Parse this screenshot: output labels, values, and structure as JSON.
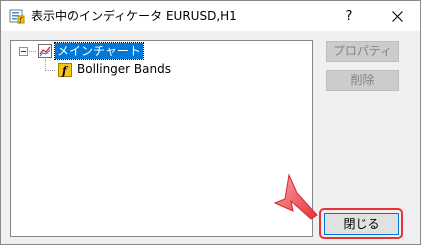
{
  "window": {
    "title": "表示中のインディケータ EURUSD,H1",
    "help_label": "?",
    "close_icon": "close-icon",
    "title_icon": "indicators-list-icon"
  },
  "tree": {
    "nodes": [
      {
        "label": "メインチャート",
        "icon": "chart-icon",
        "selected": true,
        "expanded": true
      },
      {
        "label": "Bollinger Bands",
        "icon": "function-icon",
        "selected": false
      }
    ]
  },
  "buttons": {
    "properties_label": "プロパティ",
    "delete_label": "削除",
    "close_label": "閉じる"
  },
  "colors": {
    "selection": "#0078d7",
    "highlight": "#e8333a",
    "function_icon_fill": "#f5c518"
  }
}
